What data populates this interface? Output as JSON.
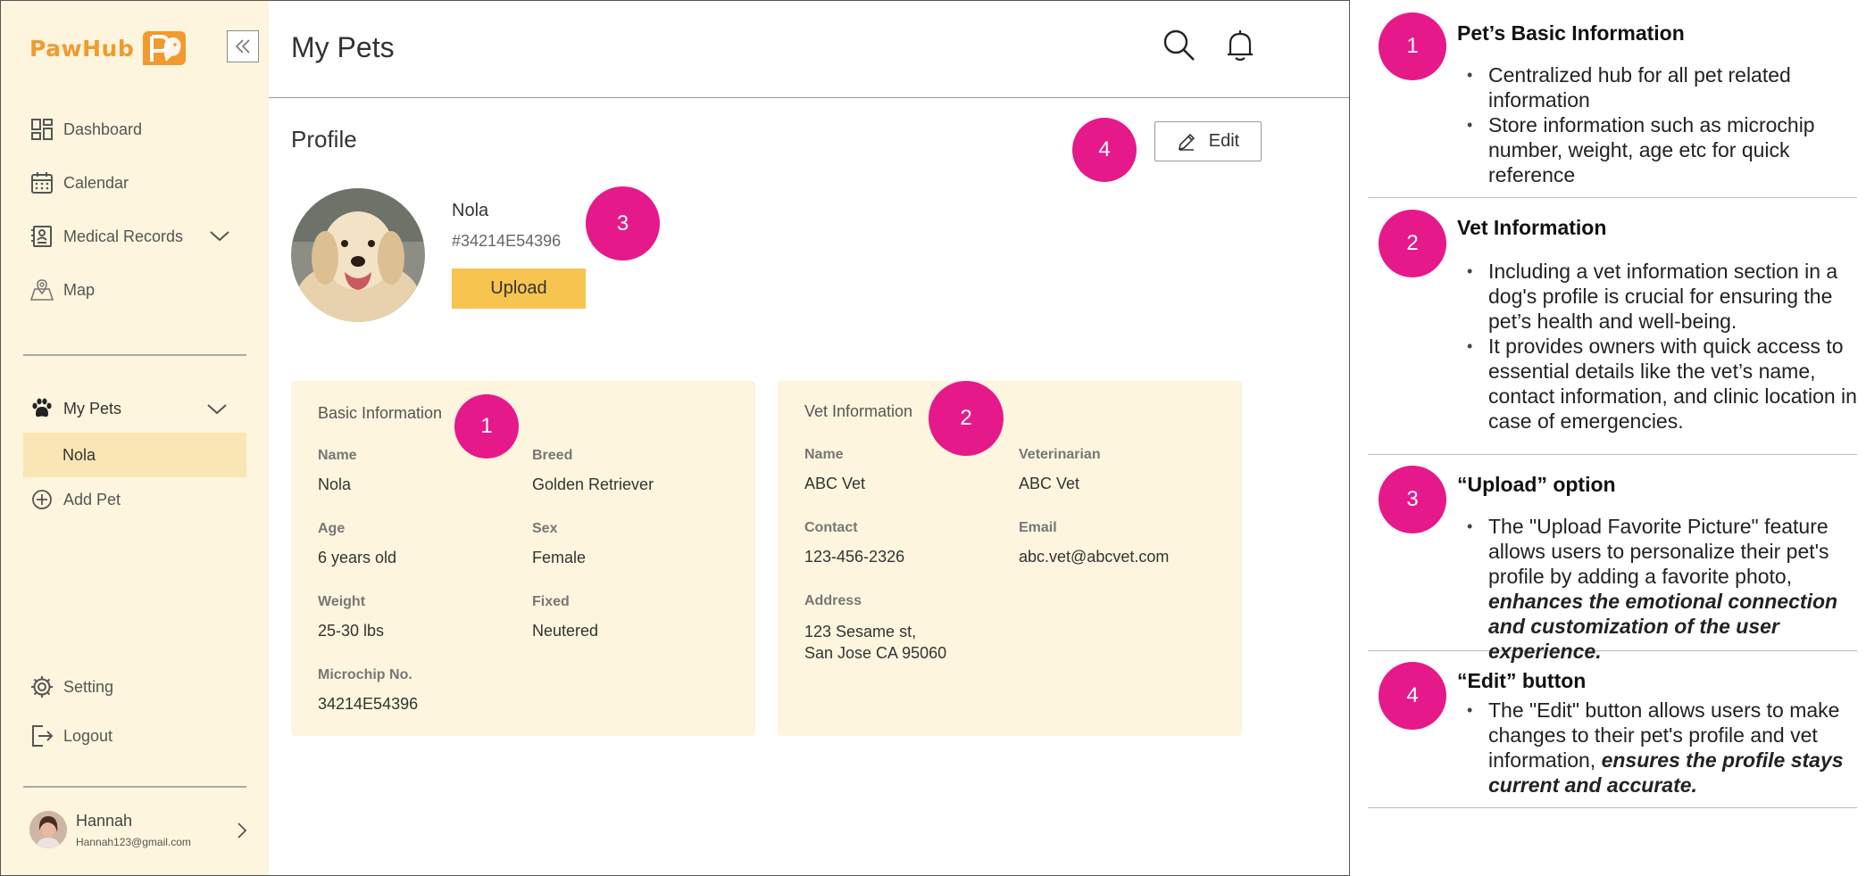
{
  "app": {
    "logo_text": "PawHub",
    "page_title": "My Pets",
    "nav": {
      "dashboard": "Dashboard",
      "calendar": "Calendar",
      "medical_records": "Medical Records",
      "map": "Map",
      "my_pets": "My Pets",
      "pet_nola": "Nola",
      "add_pet": "Add Pet",
      "setting": "Setting",
      "logout": "Logout"
    },
    "user": {
      "name": "Hannah",
      "email": "Hannah123@gmail.com"
    }
  },
  "profile": {
    "section_title": "Profile",
    "edit_label": "Edit",
    "pet_name": "Nola",
    "pet_id": "#34214E54396",
    "upload_label": "Upload"
  },
  "basic_info": {
    "title": "Basic Information",
    "fields": {
      "name": {
        "label": "Name",
        "value": "Nola"
      },
      "breed": {
        "label": "Breed",
        "value": "Golden Retriever"
      },
      "age": {
        "label": "Age",
        "value": "6 years old"
      },
      "sex": {
        "label": "Sex",
        "value": "Female"
      },
      "weight": {
        "label": "Weight",
        "value": "25-30 lbs"
      },
      "fixed": {
        "label": "Fixed",
        "value": "Neutered"
      },
      "microchip": {
        "label": "Microchip No.",
        "value": "34214E54396"
      }
    }
  },
  "vet_info": {
    "title": "Vet Information",
    "fields": {
      "name": {
        "label": "Name",
        "value": "ABC Vet"
      },
      "veterinarian": {
        "label": "Veterinarian",
        "value": "ABC Vet"
      },
      "contact": {
        "label": "Contact",
        "value": "123-456-2326"
      },
      "email": {
        "label": "Email",
        "value": "abc.vet@abcvet.com"
      },
      "address": {
        "label": "Address",
        "line1": "123 Sesame st,",
        "line2": "San Jose CA 95060"
      }
    }
  },
  "callouts": [
    "1",
    "2",
    "3",
    "4"
  ],
  "notes": [
    {
      "number": "1",
      "title": "Pet’s Basic Information",
      "bullets": [
        "Centralized hub for all pet related information",
        "Store information such as microchip number, weight, age etc for quick reference"
      ]
    },
    {
      "number": "2",
      "title": "Vet Information",
      "bullets": [
        "Including a vet information section in a dog's profile is crucial for ensuring the pet’s health and well-being.",
        "It provides owners with quick access to essential details like the vet’s name, contact information, and clinic location in case of emergencies."
      ]
    },
    {
      "number": "3",
      "title": "“Upload” option",
      "bullet_plain": "The \"Upload Favorite Picture\" feature allows users to personalize their pet's profile by adding a favorite photo, ",
      "bullet_emph": "enhances the emotional connection and customization of the user experience."
    },
    {
      "number": "4",
      "title": "“Edit” button",
      "bullet_plain": "The \"Edit\" button allows users to make changes to their pet's profile and vet information, ",
      "bullet_emph": "ensures the profile stays current and accurate."
    }
  ],
  "colors": {
    "sidebar_bg": "#fdf5dd",
    "active_item_bg": "#fae6b4",
    "accent_orange": "#f29a2e",
    "upload_yellow": "#f6c44f",
    "callout_magenta": "#e6198b"
  }
}
